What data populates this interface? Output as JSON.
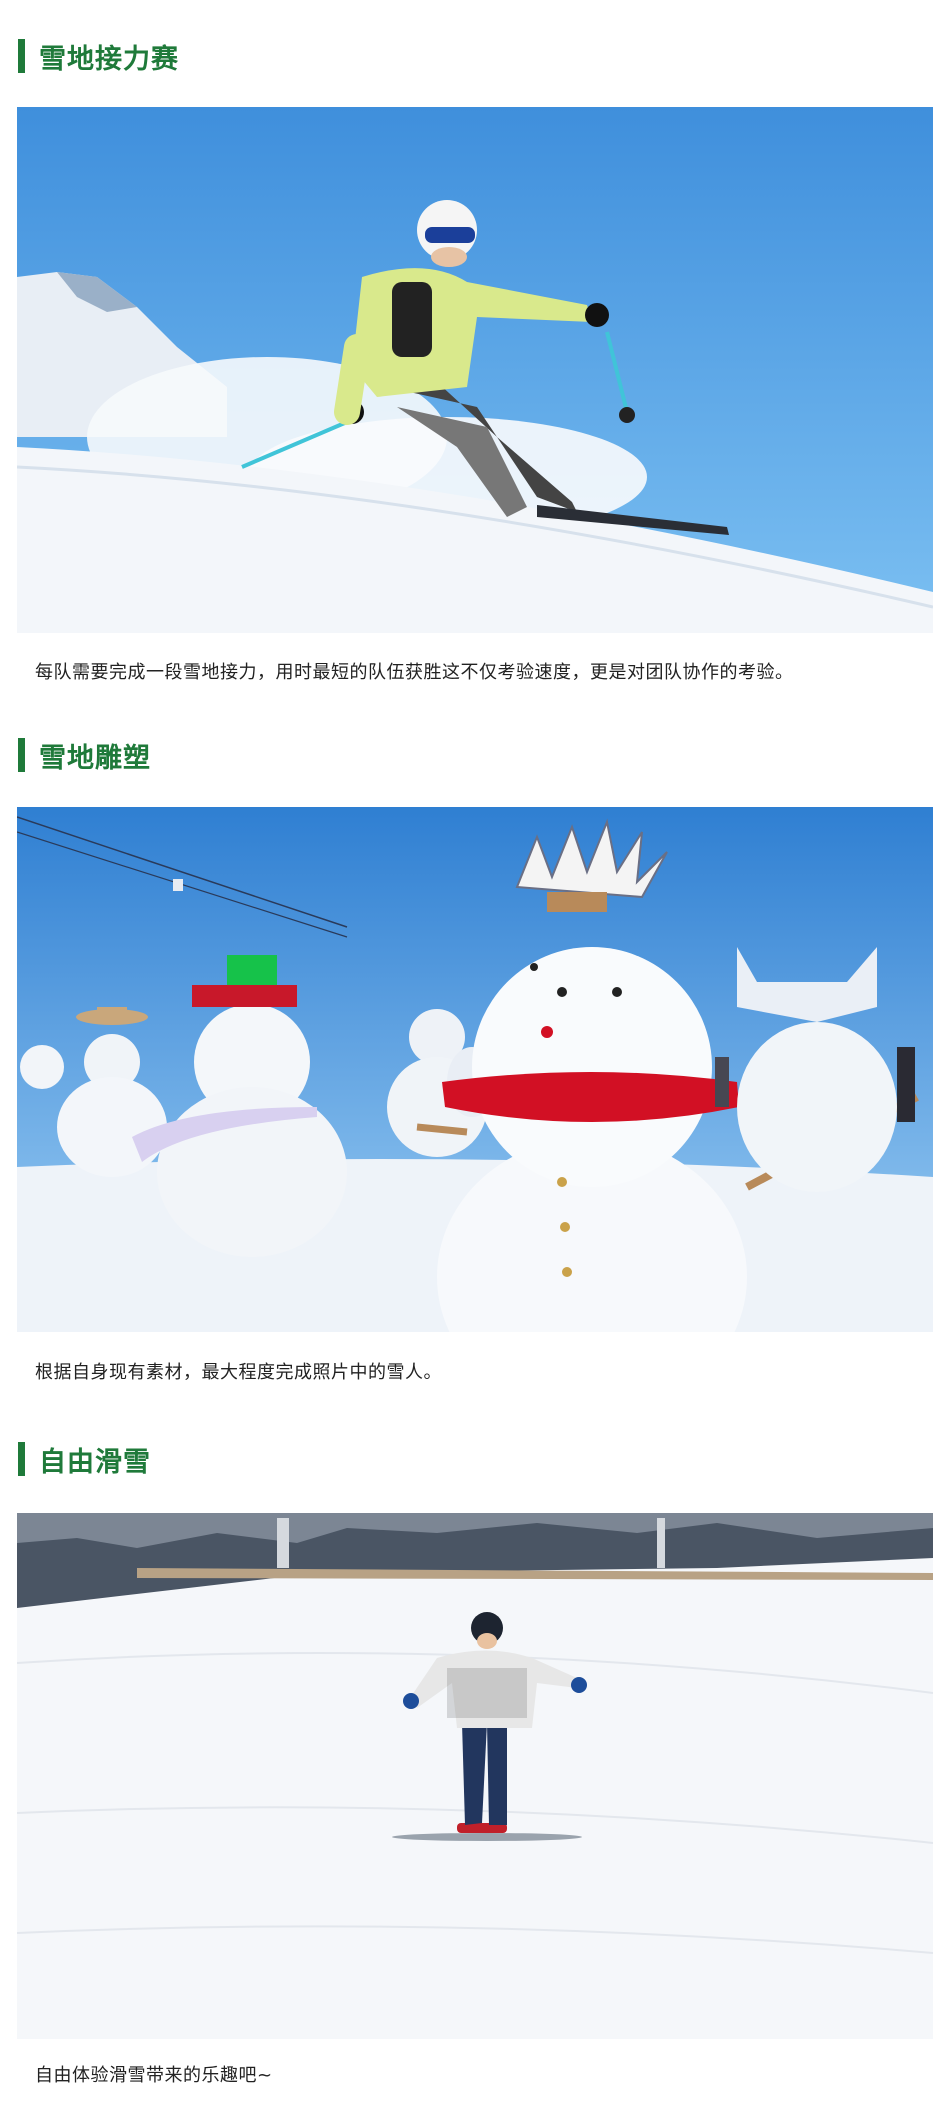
{
  "sections": [
    {
      "title": "雪地接力赛",
      "image_icon": "skier-image",
      "caption": "每队需要完成一段雪地接力，用时最短的队伍获胜这不仅考验速度，更是对团队协作的考验。"
    },
    {
      "title": "雪地雕塑",
      "image_icon": "snowman-image",
      "caption": "根据自身现有素材，最大程度完成照片中的雪人。"
    },
    {
      "title": "自由滑雪",
      "image_icon": "snowboarder-image",
      "caption": "自由体验滑雪带来的乐趣吧~"
    }
  ],
  "colors": {
    "accent": "#1f7a3a",
    "sky": "#4a9fe6",
    "snow": "#f4f7fb"
  }
}
